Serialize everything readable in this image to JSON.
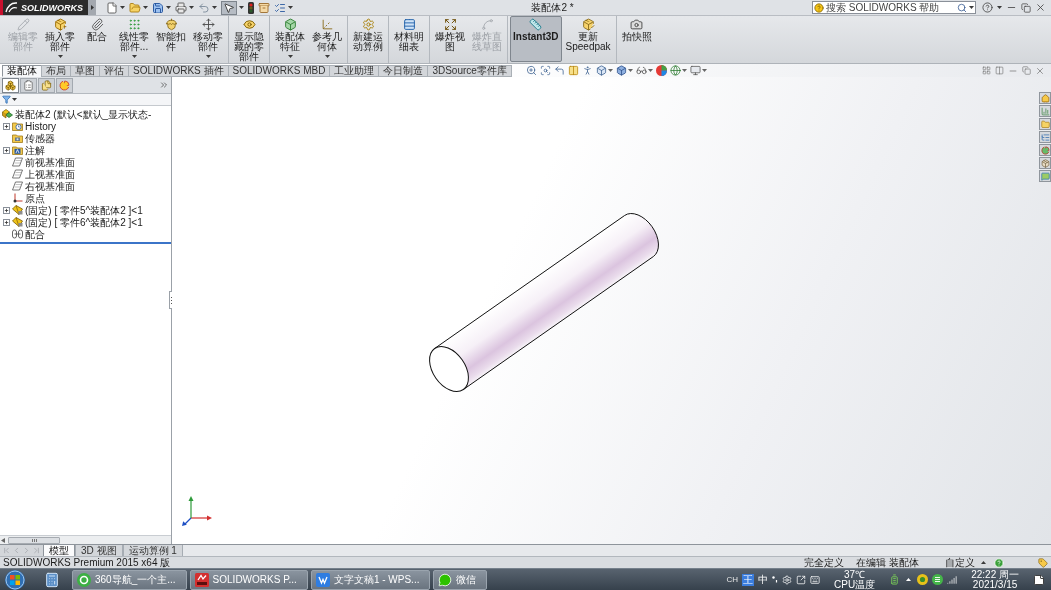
{
  "title_bar": {
    "app_name": "SOLIDWORKS",
    "quick_access": [
      {
        "has_menu": true,
        "selected": false
      },
      {
        "has_menu": true,
        "selected": false
      },
      {
        "has_menu": true,
        "selected": false
      },
      {
        "has_menu": true,
        "selected": false
      },
      {
        "has_menu": true,
        "selected": false
      },
      {
        "has_menu": true,
        "selected": true
      },
      {
        "has_menu": false,
        "selected": false
      },
      {
        "has_menu": false,
        "selected": false
      },
      {
        "has_menu": true,
        "selected": false
      }
    ],
    "document_title": "装配体2 *",
    "search": {
      "placeholder": "搜索 SOLIDWORKS 帮助"
    }
  },
  "command_manager": {
    "groups": [
      {
        "buttons": [
          {
            "label": "编辑零部件",
            "disabled": true,
            "has_menu": false,
            "selected": false
          },
          {
            "label": "插入零部件",
            "disabled": false,
            "has_menu": true,
            "selected": false
          },
          {
            "label": "配合",
            "disabled": false,
            "has_menu": false,
            "selected": false
          },
          {
            "label": "线性零部件...",
            "disabled": false,
            "has_menu": true,
            "selected": false
          },
          {
            "label": "智能扣件",
            "disabled": false,
            "has_menu": false,
            "selected": false
          },
          {
            "label": "移动零部件",
            "disabled": false,
            "has_menu": true,
            "selected": false
          }
        ]
      },
      {
        "buttons": [
          {
            "label": "显示隐藏的零部件",
            "disabled": false,
            "has_menu": false,
            "selected": false
          }
        ]
      },
      {
        "buttons": [
          {
            "label": "装配体特征",
            "disabled": false,
            "has_menu": true,
            "selected": false
          },
          {
            "label": "参考几何体",
            "disabled": false,
            "has_menu": true,
            "selected": false
          }
        ]
      },
      {
        "buttons": [
          {
            "label": "新建运动算例",
            "disabled": false,
            "has_menu": false,
            "selected": false
          }
        ]
      },
      {
        "buttons": [
          {
            "label": "材料明细表",
            "disabled": false,
            "has_menu": false,
            "selected": false
          }
        ]
      },
      {
        "buttons": [
          {
            "label": "爆炸视图",
            "disabled": false,
            "has_menu": false,
            "selected": false
          },
          {
            "label": "爆炸直线草图",
            "disabled": true,
            "has_menu": false,
            "selected": false
          }
        ]
      },
      {
        "buttons": [
          {
            "label": "Instant3D",
            "disabled": false,
            "has_menu": false,
            "selected": true
          },
          {
            "label": "更新Speedpak",
            "disabled": false,
            "has_menu": false,
            "selected": false
          }
        ]
      },
      {
        "buttons": [
          {
            "label": "拍快照",
            "disabled": false,
            "has_menu": false,
            "selected": false
          }
        ]
      }
    ],
    "tabs": [
      {
        "label": "装配体",
        "selected": true
      },
      {
        "label": "布局",
        "selected": false
      },
      {
        "label": "草图",
        "selected": false
      },
      {
        "label": "评估",
        "selected": false
      },
      {
        "label": "SOLIDWORKS 插件",
        "selected": false
      },
      {
        "label": "SOLIDWORKS MBD",
        "selected": false
      },
      {
        "label": "工业助理",
        "selected": false
      },
      {
        "label": "今日制造",
        "selected": false
      },
      {
        "label": "3DSource零件库",
        "selected": false
      }
    ]
  },
  "graphics_area": {
    "heads_up_toolbar": [
      {
        "has_menu": false
      },
      {
        "has_menu": false
      },
      {
        "has_menu": false
      },
      {
        "has_menu": false
      },
      {
        "has_menu": false
      },
      {
        "has_menu": true
      },
      {
        "has_menu": true
      },
      {
        "has_menu": true
      },
      {
        "has_menu": false
      },
      {
        "has_menu": true
      },
      {
        "has_menu": true
      }
    ]
  },
  "feature_manager": {
    "tabs": [
      {
        "selected": true
      },
      {
        "selected": false
      },
      {
        "selected": false
      },
      {
        "selected": false
      }
    ],
    "tree": {
      "label": "装配体2 (默认<默认_显示状态-",
      "children": [
        {
          "label": "History",
          "kind": "history",
          "expandable": true
        },
        {
          "label": "传感器",
          "kind": "sensors",
          "expandable": false
        },
        {
          "label": "注解",
          "kind": "annotations",
          "expandable": true
        },
        {
          "label": "前视基准面",
          "kind": "plane",
          "expandable": false
        },
        {
          "label": "上视基准面",
          "kind": "plane",
          "expandable": false
        },
        {
          "label": "右视基准面",
          "kind": "plane",
          "expandable": false
        },
        {
          "label": "原点",
          "kind": "origin",
          "expandable": false
        },
        {
          "label": "(固定) [ 零件5^装配体2 ]<1",
          "kind": "part",
          "expandable": true
        },
        {
          "label": "(固定) [ 零件6^装配体2 ]<1",
          "kind": "part",
          "expandable": true
        },
        {
          "label": "配合",
          "kind": "mates",
          "expandable": false
        }
      ]
    }
  },
  "bottom_tabs": [
    {
      "label": "模型",
      "selected": true
    },
    {
      "label": "3D 视图",
      "selected": false
    },
    {
      "label": "运动算例 1",
      "selected": false
    }
  ],
  "status_bar": {
    "product": "SOLIDWORKS Premium 2015 x64 版",
    "fields": [
      "完全定义",
      "在编辑 装配体",
      "自定义"
    ]
  },
  "taskbar": {
    "tasks": [
      {
        "label": "360导航_一个主..."
      },
      {
        "label": "SOLIDWORKS P..."
      },
      {
        "label": "文字文稿1 - WPS..."
      },
      {
        "label": "微信"
      }
    ],
    "tray": {
      "language": "CH",
      "ime_badge": "王",
      "ime_mode": "中",
      "temperature": "37℃",
      "temperature_label": "CPU温度",
      "time": "22:22 周一",
      "date": "2021/3/15"
    }
  }
}
